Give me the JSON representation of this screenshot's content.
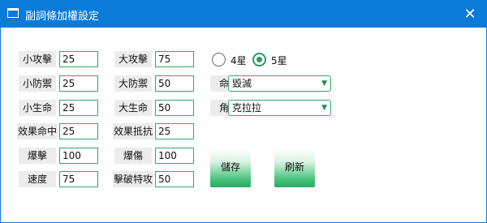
{
  "window": {
    "title": "副詞條加權設定",
    "close_glyph": "✕"
  },
  "stats_left": [
    {
      "label": "小攻擊",
      "value": "25"
    },
    {
      "label": "小防禦",
      "value": "25"
    },
    {
      "label": "小生命",
      "value": "25"
    },
    {
      "label": "效果命中",
      "value": "25"
    },
    {
      "label": "爆擊",
      "value": "100"
    },
    {
      "label": "速度",
      "value": "75"
    }
  ],
  "stats_right": [
    {
      "label": "大攻擊",
      "value": "75"
    },
    {
      "label": "大防禦",
      "value": "50"
    },
    {
      "label": "大生命",
      "value": "50"
    },
    {
      "label": "效果抵抗",
      "value": "25"
    },
    {
      "label": "爆傷",
      "value": "100"
    },
    {
      "label": "擊破特攻",
      "value": "50"
    }
  ],
  "star_options": [
    {
      "label": "4星",
      "selected": false
    },
    {
      "label": "5星",
      "selected": true
    }
  ],
  "path": {
    "label": "命途",
    "value": "毀滅"
  },
  "character": {
    "label": "角色",
    "value": "克拉拉"
  },
  "buttons": {
    "save": "儲存",
    "refresh": "刷新"
  },
  "colors": {
    "titlebar": "#0a7bd8",
    "accent": "#2a9960"
  }
}
